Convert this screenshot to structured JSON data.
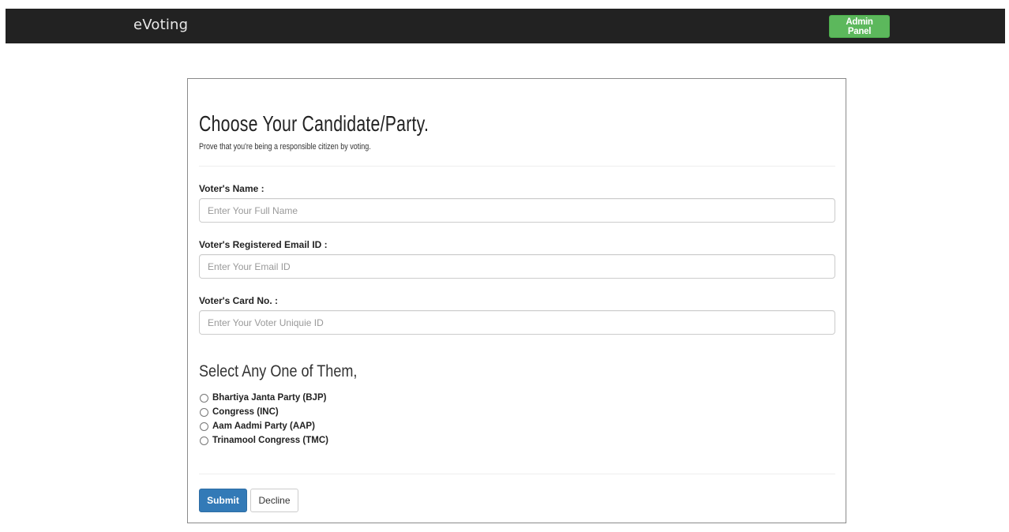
{
  "navbar": {
    "brand": "eVoting",
    "admin_button": "Admin Panel"
  },
  "form": {
    "title": "Choose Your Candidate/Party.",
    "subtitle": "Prove that you're being a responsible citizen by voting.",
    "fields": [
      {
        "label": "Voter's Name :",
        "placeholder": "Enter Your Full Name",
        "value": ""
      },
      {
        "label": "Voter's Registered Email ID :",
        "placeholder": "Enter Your Email ID",
        "value": ""
      },
      {
        "label": "Voter's Card No. :",
        "placeholder": "Enter Your Voter Uniquie ID",
        "value": ""
      }
    ],
    "select_title": "Select Any One of Them,",
    "parties": [
      "Bhartiya Janta Party (BJP)",
      "Congress (INC)",
      "Aam Aadmi Party (AAP)",
      "Trinamool Congress (TMC)"
    ],
    "submit_label": "Submit",
    "decline_label": "Decline"
  },
  "colors": {
    "navbar_bg": "#222222",
    "admin_button": "#5cb85c",
    "submit_button": "#337ab7"
  }
}
